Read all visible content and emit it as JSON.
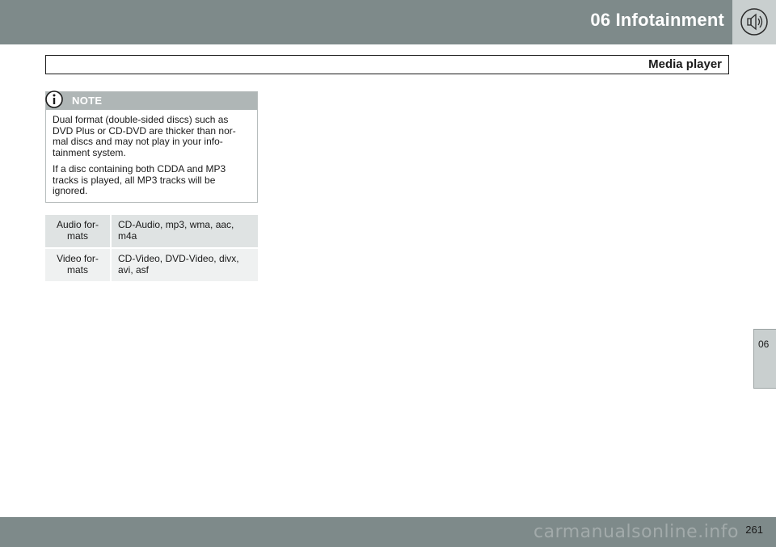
{
  "header": {
    "chapter_title": "06  Infotainment",
    "section_title": "Media player"
  },
  "note": {
    "label": "NOTE",
    "paragraphs": [
      "Dual format (double-sided discs) such as DVD Plus or CD-DVD are thicker than nor-mal discs and may not play in your info-tainment system.",
      "If a disc containing both CDDA and MP3 tracks is played, all MP3 tracks will be ignored."
    ]
  },
  "formats_table": {
    "rows": [
      {
        "label": "Audio for-mats",
        "value": "CD-Audio, mp3, wma, aac, m4a"
      },
      {
        "label": "Video for-mats",
        "value": "CD-Video, DVD-Video, divx, avi, asf"
      }
    ]
  },
  "side_tab": {
    "label": "06"
  },
  "footer": {
    "page_number": "261",
    "watermark": "carmanualsonline.info"
  },
  "icons": {
    "speaker": "speaker-icon",
    "info": "info-icon"
  },
  "colors": {
    "bar": "#7e8a8a",
    "tab": "#c9cfcf",
    "note_header": "#afb6b6"
  }
}
